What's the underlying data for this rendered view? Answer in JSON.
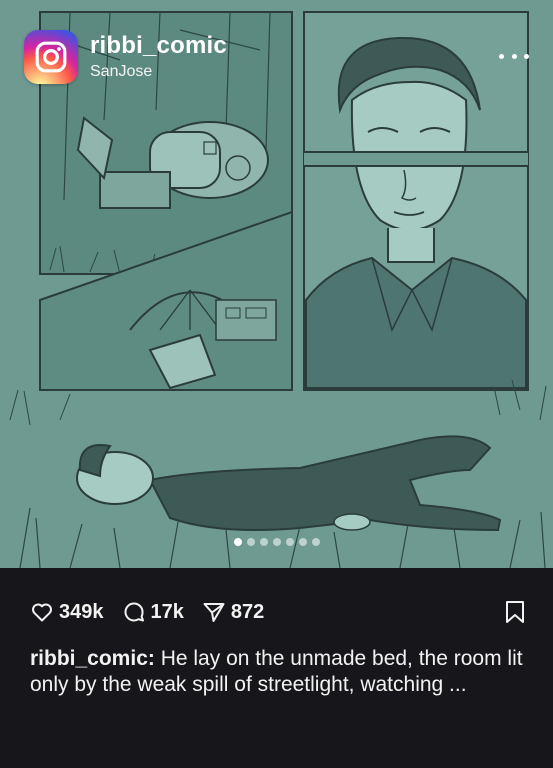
{
  "post": {
    "username": "ribbi_comic",
    "location": "SanJose",
    "likes": "349k",
    "comments": "17k",
    "shares": "872",
    "caption_user": "ribbi_comic:",
    "caption_text": " He lay on the unmade bed, the room lit only by the weak spill of streetlight, watching ...",
    "carousel": {
      "total": 7,
      "active": 1
    }
  },
  "colors": {
    "background": "#17171b",
    "panel_tint": "#6e9a91",
    "ink": "#2a3d3b"
  },
  "icons": {
    "profile": "instagram-logo-icon",
    "more": "more-options-icon",
    "like": "heart-icon",
    "comment": "comment-bubble-icon",
    "share": "send-arrow-icon",
    "save": "bookmark-icon"
  }
}
